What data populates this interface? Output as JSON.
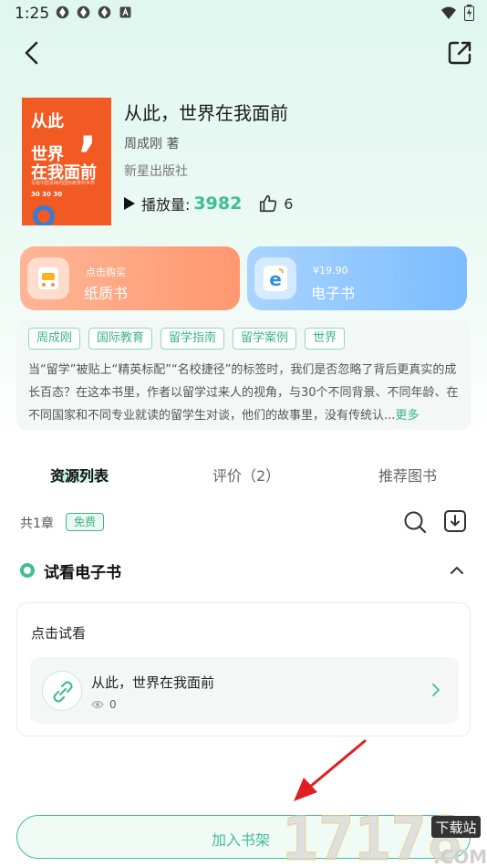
{
  "status_bar": {
    "time": "1:25"
  },
  "book": {
    "title": "从此，世界在我面前",
    "author": "周成刚 著",
    "publisher": "新星出版社",
    "play_label": "播放量:",
    "play_count": "3982",
    "like_count": "6",
    "cover": {
      "line1": "从此",
      "line2": "世界",
      "line3": "在我面前",
      "subtitle": "写给中国青睐的国际教育的世界",
      "numbers": "30 30 30"
    }
  },
  "purchase": {
    "paper": {
      "small": "点击购买",
      "label": "纸质书"
    },
    "ebook": {
      "small": "¥19.90",
      "label": "电子书"
    }
  },
  "tags": [
    "周成刚",
    "国际教育",
    "留学指南",
    "留学案例",
    "世界"
  ],
  "intro": {
    "text": "当“留学”被贴上“精英标配”“名校捷径”的标签时，我们是否忽略了背后更真实的成长百态？在这本书里，作者以留学过来人的视角，与30个不同背景、不同年龄、在不同国家和不同专业就读的留学生对谈，他们的故事里，没有传统认...",
    "more": "更多"
  },
  "tabs": [
    "资源列表",
    "评价（2）",
    "推荐图书"
  ],
  "list_header": {
    "count": "共1章",
    "badge": "免费"
  },
  "section": {
    "title": "试看电子书",
    "preview_label": "点击试看",
    "item_title": "从此，世界在我面前",
    "item_views": "0"
  },
  "bottom": {
    "add_shelf": "加入书架"
  },
  "watermark": {
    "text": "17178",
    "sub": "下载站",
    "domain": ".COM"
  },
  "colors": {
    "accent": "#3fbf90",
    "paper_card": "#ff9f7a",
    "ebook_card": "#8cc6ff",
    "cover": "#f15a23"
  },
  "icons": [
    "back-icon",
    "share-icon",
    "play-icon",
    "thumb-up-icon",
    "search-icon",
    "download-icon",
    "chevron-up-icon",
    "link-icon",
    "eye-icon",
    "chevron-right-icon"
  ]
}
